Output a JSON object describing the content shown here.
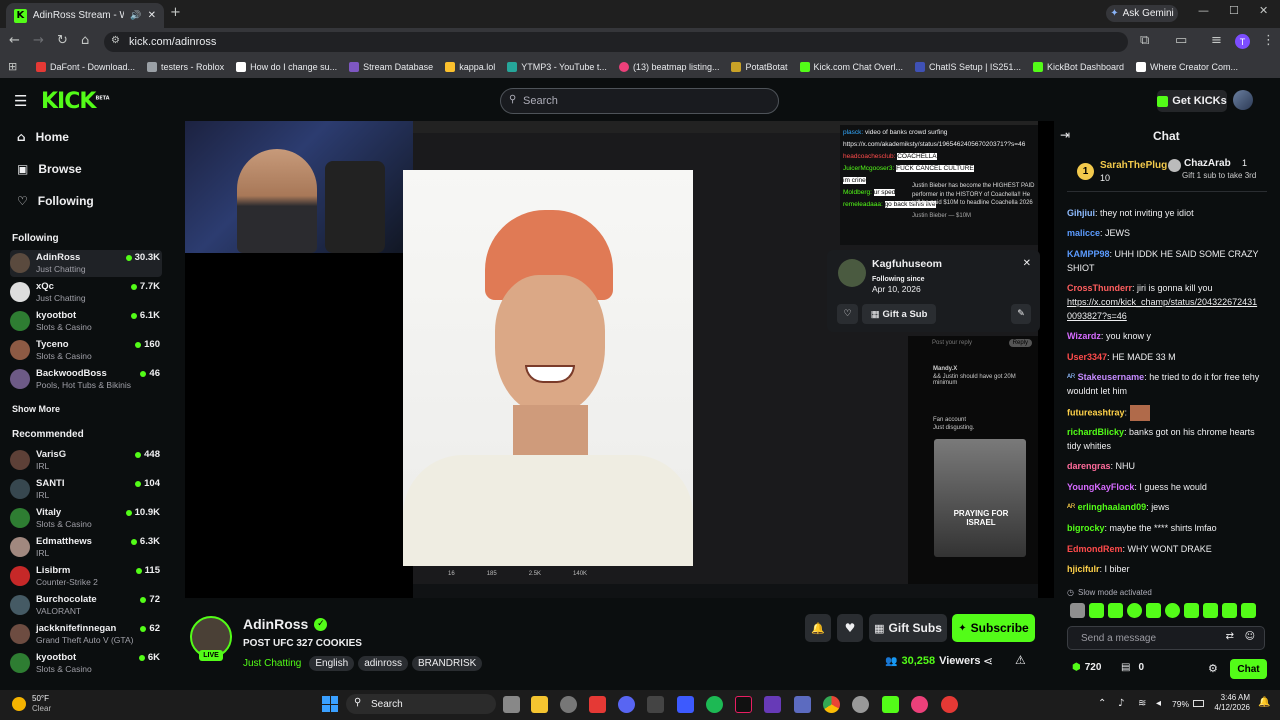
{
  "browser": {
    "tab_title": "AdinRoss Stream - Watch L",
    "url": "kick.com/adinross",
    "ask_gemini": "Ask Gemini",
    "bookmarks": [
      "DaFont - Download...",
      "testers - Roblox",
      "How do I change su...",
      "Stream Database",
      "kappa.lol",
      "YTMP3 - YouTube t...",
      "(13) beatmap listing...",
      "PotatBotat",
      "Kick.com Chat Overl...",
      "ChatIS Setup | IS251...",
      "KickBot Dashboard",
      "Where Creator Com..."
    ]
  },
  "header": {
    "logo": "KICK",
    "logo_beta": "BETA",
    "search_placeholder": "Search",
    "get_kicks": "Get KICKs"
  },
  "sidebar": {
    "nav": [
      "Home",
      "Browse",
      "Following"
    ],
    "following_title": "Following",
    "following": [
      {
        "name": "AdinRoss",
        "category": "Just Chatting",
        "viewers": "30.3K"
      },
      {
        "name": "xQc",
        "category": "Just Chatting",
        "viewers": "7.7K"
      },
      {
        "name": "kyootbot",
        "category": "Slots & Casino",
        "viewers": "6.1K"
      },
      {
        "name": "Tyceno",
        "category": "Slots & Casino",
        "viewers": "160"
      },
      {
        "name": "BackwoodBoss",
        "category": "Pools, Hot Tubs & Bikinis",
        "viewers": "46"
      }
    ],
    "show_more": "Show More",
    "recommended_title": "Recommended",
    "recommended": [
      {
        "name": "VarisG",
        "category": "IRL",
        "viewers": "448"
      },
      {
        "name": "SANTI",
        "category": "IRL",
        "viewers": "104"
      },
      {
        "name": "Vitaly",
        "category": "Slots & Casino",
        "viewers": "10.9K"
      },
      {
        "name": "Edmatthews",
        "category": "IRL",
        "viewers": "6.3K"
      },
      {
        "name": "Lisibrm",
        "category": "Counter-Strike 2",
        "viewers": "115"
      },
      {
        "name": "Burchocolate",
        "category": "VALORANT",
        "viewers": "72"
      },
      {
        "name": "jackknifefinnegan",
        "category": "Grand Theft Auto V (GTA)",
        "viewers": "62"
      },
      {
        "name": "kyootbot",
        "category": "Slots & Casino",
        "viewers": "6K"
      }
    ]
  },
  "player": {
    "inner_chat": [
      {
        "user": "plasck:",
        "text": "video of banks crowd surfing"
      },
      {
        "user": "",
        "text": "https://x.com/akademiksty/status/196546240567020371??s=46"
      },
      {
        "user": "headcoachesclub:",
        "text": "COACHELLA"
      },
      {
        "user": "JuicerMcgooser3:",
        "text": "FUCK CANCEL CULTURE"
      },
      {
        "user": "",
        "text": "im crine"
      },
      {
        "user": "Moldberg:",
        "text": "ur sped"
      },
      {
        "user": "remeleadaaa:",
        "text": "go back tsihis live"
      }
    ],
    "inner_tweet": "Justin Bieber has become the HIGHEST PAID performer in the HISTORY of Coachella!! He will be paid $10M to headline Coachella 2026",
    "inner_tweet_author": "Justin Bieber — $10M",
    "usercard": {
      "name": "Kagfuhuseom",
      "following_since_label": "Following since",
      "following_since": "Apr 10, 2026",
      "gift_sub": "Gift a Sub"
    },
    "tweet_reply_placeholder": "Post your reply",
    "tweet_reply_btn": "Reply",
    "reply1": "Mandy.X",
    "reply1_text": "&& Justin should have got 20M minimum",
    "reply2": "Fan account",
    "reply2_text": "Just disgusting.",
    "praying": "PRAYING FOR ISRAEL",
    "inner_counts": [
      "16",
      "185",
      "2.5K",
      "140K"
    ]
  },
  "stream": {
    "streamer": "AdinRoss",
    "title": "POST UFC 327 COOKIES",
    "category": "Just Chatting",
    "tags": [
      "English",
      "adinross",
      "BRANDRISK"
    ],
    "live": "LIVE",
    "viewers": "30,258",
    "viewers_label": "Viewers",
    "gift_subs": "Gift Subs",
    "subscribe": "Subscribe"
  },
  "chat": {
    "title": "Chat",
    "pinned": {
      "rank": "1",
      "user": "SarahThePlug",
      "count": "10",
      "user2": "ChazArab",
      "count2": "1",
      "gift_text": "Gift 1 sub to take 3rd"
    },
    "messages": [
      {
        "user": "Gihjiui",
        "color": "#8fbcff",
        "text": "they not inviting ye idiot"
      },
      {
        "user": "malicce",
        "color": "#5b9bff",
        "text": "JEWS"
      },
      {
        "user": "KAMPP98",
        "color": "#5b9bff",
        "text": "UHH IDDK HE SAID SOME CRAZY SHIOT"
      },
      {
        "user": "CrossThunderr",
        "color": "#ff5e5e",
        "text": "jiri is gonna kill you"
      },
      {
        "user": "",
        "color": "#efeff1",
        "text": "https://x.com/kick_champ/status/2043226724310093827?s=46"
      },
      {
        "user": "Wizardz",
        "color": "#d66bff",
        "text": "you know y"
      },
      {
        "user": "User3347",
        "color": "#ff4b4b",
        "text": "HE MADE 33 M"
      },
      {
        "user": "Stakeusername",
        "color": "#c58bff",
        "text": "he tried to do it for free tehy wouldnt let him"
      },
      {
        "user": "futureashtray",
        "color": "#ffd24a",
        "text": ""
      },
      {
        "user": "richardBlicky",
        "color": "#53fc18",
        "text": "banks got on his chrome hearts tidy whities"
      },
      {
        "user": "darengras",
        "color": "#ff6b9b",
        "text": "NHU"
      },
      {
        "user": "YoungKayFlock",
        "color": "#d66bff",
        "text": "I guess he would"
      },
      {
        "user": "erlinghaaland09",
        "color": "#53fc18",
        "text": "jews"
      },
      {
        "user": "bigrocky",
        "color": "#53fc18",
        "text": "maybe the **** shirts lmfao"
      },
      {
        "user": "EdmondRem",
        "color": "#ff4b4b",
        "text": "WHY WONT DRAKE"
      },
      {
        "user": "hjicifulr",
        "color": "#ffd24a",
        "text": "I biber"
      }
    ],
    "slow_mode": "Slow mode activated",
    "input_placeholder": "Send a message",
    "kicks": "720",
    "second_count": "0",
    "send": "Chat"
  },
  "taskbar": {
    "weather_temp": "50°F",
    "weather_desc": "Clear",
    "search": "Search",
    "battery": "79%",
    "time": "3:46 AM",
    "date": "4/12/2026"
  }
}
